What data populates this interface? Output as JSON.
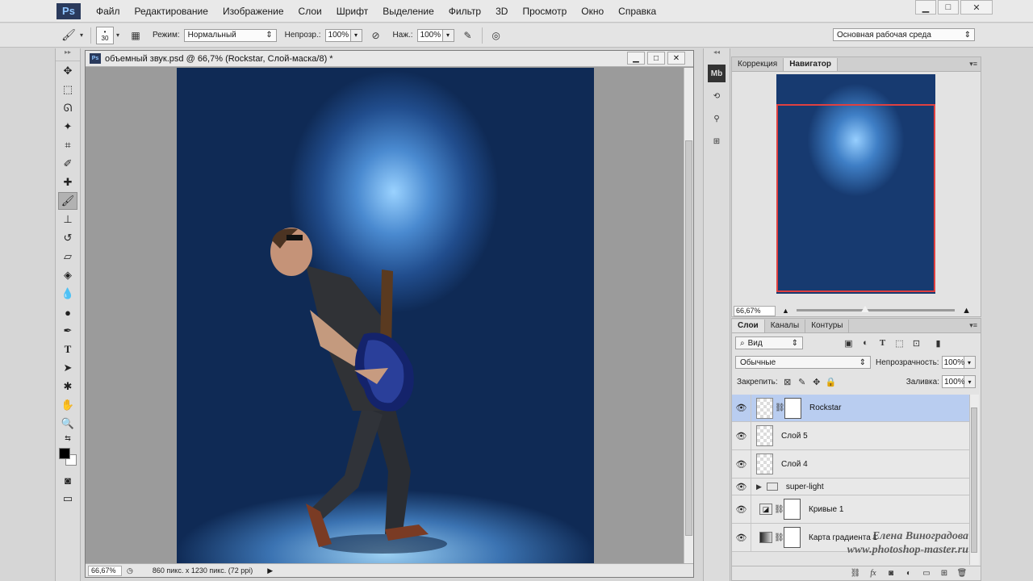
{
  "app": {
    "logo": "Ps"
  },
  "menu": [
    "Файл",
    "Редактирование",
    "Изображение",
    "Слои",
    "Шрифт",
    "Выделение",
    "Фильтр",
    "3D",
    "Просмотр",
    "Окно",
    "Справка"
  ],
  "window_controls": {
    "minimize": "▁",
    "maximize": "□",
    "close": "✕"
  },
  "options": {
    "brush_size": "30",
    "mode_label": "Режим:",
    "mode_value": "Нормальный",
    "opacity_label": "Непрозр.:",
    "opacity_value": "100%",
    "pressure_label": "Наж.:",
    "pressure_value": "100%",
    "workspace": "Основная рабочая среда"
  },
  "document": {
    "title": "объемный звук.psd @ 66,7% (Rockstar, Слой-маска/8) *",
    "zoom": "66,67%",
    "status": "860 пикс. x 1230 пикс. (72 ppi)"
  },
  "navigator": {
    "tabs": [
      "Коррекция",
      "Навигатор"
    ],
    "active_tab": 1,
    "zoom": "66,67%"
  },
  "layers_panel": {
    "tabs": [
      "Слои",
      "Каналы",
      "Контуры"
    ],
    "filter_label": "Вид",
    "blend_mode": "Обычные",
    "opacity_label": "Непрозрачность:",
    "opacity_value": "100%",
    "lock_label": "Закрепить:",
    "fill_label": "Заливка:",
    "fill_value": "100%",
    "layers": [
      {
        "name": "Rockstar",
        "type": "masked",
        "selected": true
      },
      {
        "name": "Слой 5",
        "type": "normal",
        "selected": false
      },
      {
        "name": "Слой 4",
        "type": "normal",
        "selected": false
      },
      {
        "name": "super-light",
        "type": "group",
        "selected": false
      },
      {
        "name": "Кривые 1",
        "type": "adjustment",
        "selected": false
      },
      {
        "name": "Карта градиента 1",
        "type": "adjustment",
        "selected": false
      }
    ]
  },
  "watermark": {
    "line1": "Елена Виноградова",
    "line2": "www.photoshop-master.ru"
  }
}
